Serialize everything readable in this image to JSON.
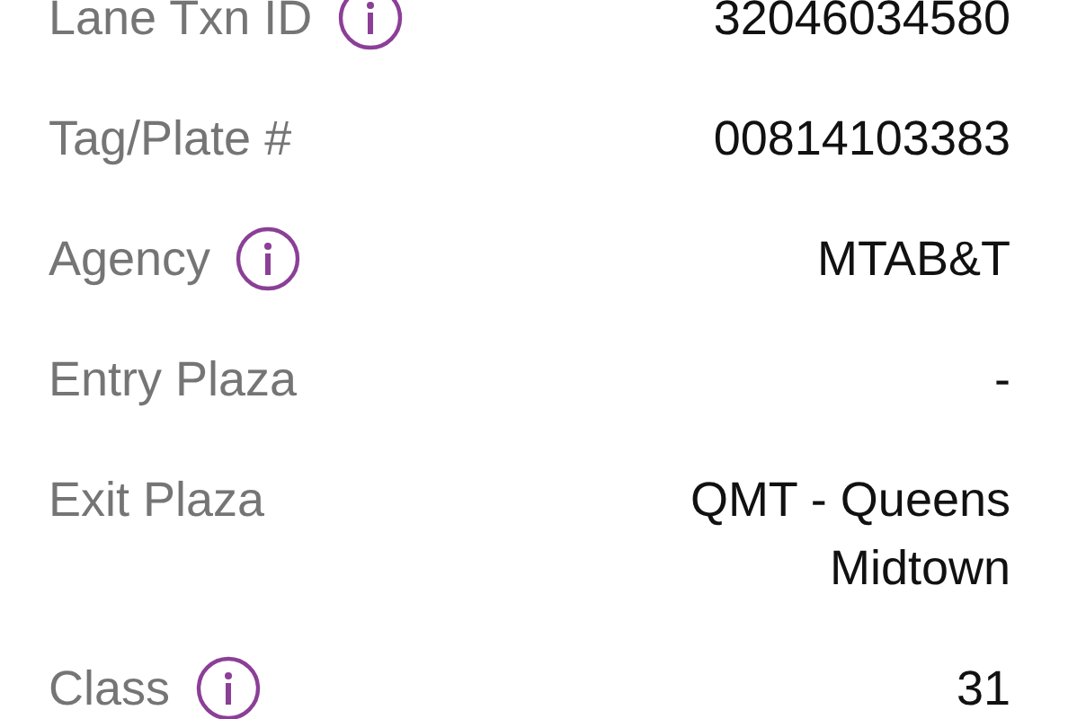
{
  "details": [
    {
      "label": "Lane Txn ID",
      "info": true,
      "value": "32046034580"
    },
    {
      "label": "Tag/Plate #",
      "info": false,
      "value": "00814103383"
    },
    {
      "label": "Agency",
      "info": true,
      "value": "MTAB&T"
    },
    {
      "label": "Entry Plaza",
      "info": false,
      "value": "-"
    },
    {
      "label": "Exit Plaza",
      "info": false,
      "value": "QMT - Queens Midtown"
    },
    {
      "label": "Class",
      "info": true,
      "value": "31"
    }
  ]
}
